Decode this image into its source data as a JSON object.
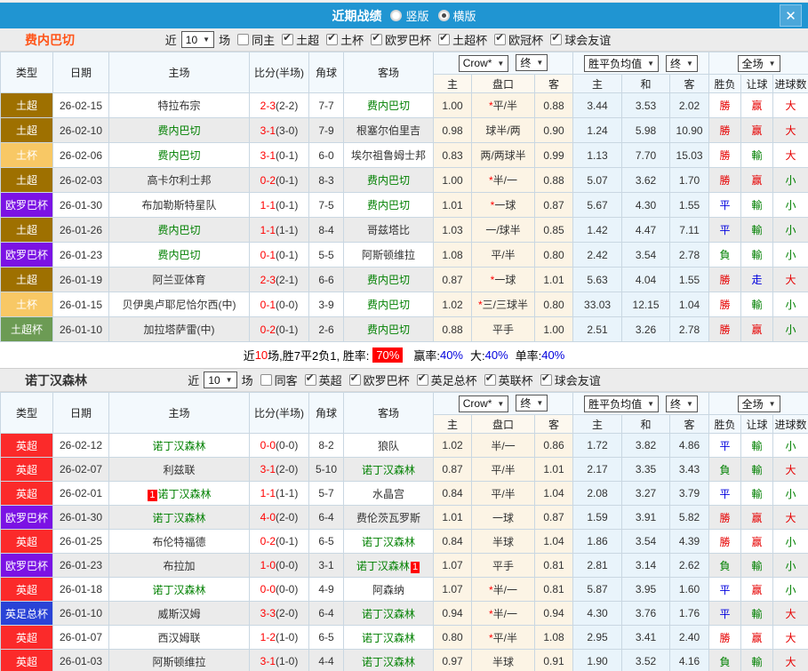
{
  "icons": {
    "dropdown": "▼",
    "close": "✕",
    "check": "✔"
  },
  "titlebar": {
    "title": "近期战绩",
    "vertical_label": "竖版",
    "horizontal_label": "横版",
    "horizontal_selected": true,
    "bg_color": "#2095d2"
  },
  "header": {
    "col_type": "类型",
    "col_date": "日期",
    "col_home": "主场",
    "col_score": "比分(半场)",
    "col_corner": "角球",
    "col_away": "客场",
    "odds_company": "Crow*",
    "odds_final": "终",
    "avg_label": "胜平负均值",
    "avg_final": "终",
    "scope": "全场",
    "sub_home": "主",
    "sub_handicap": "盘口",
    "sub_away": "客",
    "sub_win": "主",
    "sub_draw": "和",
    "sub_lose": "客",
    "col_result": "胜负",
    "col_handicap_result": "让球",
    "col_goals": "进球数"
  },
  "league_colors": {
    "土超": "#9e7000",
    "土杯": "#f8c865",
    "欧罗巴杯": "#7b12e4",
    "土超杯": "#6c9b54",
    "英超": "#fb2a2a",
    "英足总杯": "#2a43d6"
  },
  "result_colors": {
    "勝": "red",
    "平": "blue",
    "負": "green",
    "赢": "red",
    "輸": "green",
    "走": "blue",
    "大": "red",
    "小": "green"
  },
  "subject_color": "#008000",
  "sections": [
    {
      "team": "费内巴切",
      "team_color": "#ff5418",
      "filters": {
        "near_label": "近",
        "recent_value": "10",
        "matches_label": "场",
        "same_label": "同主",
        "same_checked": false,
        "leagues": [
          "土超",
          "土杯",
          "欧罗巴杯",
          "土超杯",
          "欧冠杯",
          "球会友谊"
        ]
      },
      "rows": [
        {
          "league": "土超",
          "date": "26-02-15",
          "home": "特拉布宗",
          "home_subject": false,
          "score": "2-3",
          "half": "(2-2)",
          "corner": "7-7",
          "away": "费内巴切",
          "away_subject": true,
          "odds": [
            "1.00",
            "*平/半",
            "0.88"
          ],
          "avg": [
            "3.44",
            "3.53",
            "2.02"
          ],
          "results": [
            "勝",
            "赢",
            "大"
          ]
        },
        {
          "league": "土超",
          "date": "26-02-10",
          "home": "费内巴切",
          "home_subject": true,
          "score": "3-1",
          "half": "(3-0)",
          "corner": "7-9",
          "away": "根塞尔伯里吉",
          "away_subject": false,
          "odds": [
            "0.98",
            "球半/两",
            "0.90"
          ],
          "avg": [
            "1.24",
            "5.98",
            "10.90"
          ],
          "results": [
            "勝",
            "赢",
            "大"
          ]
        },
        {
          "league": "土杯",
          "date": "26-02-06",
          "home": "费内巴切",
          "home_subject": true,
          "score": "3-1",
          "half": "(0-1)",
          "corner": "6-0",
          "away": "埃尔祖鲁姆士邦",
          "away_subject": false,
          "odds": [
            "0.83",
            "两/两球半",
            "0.99"
          ],
          "avg": [
            "1.13",
            "7.70",
            "15.03"
          ],
          "results": [
            "勝",
            "輸",
            "大"
          ]
        },
        {
          "league": "土超",
          "date": "26-02-03",
          "home": "高卡尔利士邦",
          "home_subject": false,
          "score": "0-2",
          "half": "(0-1)",
          "corner": "8-3",
          "away": "费内巴切",
          "away_subject": true,
          "odds": [
            "1.00",
            "*半/一",
            "0.88"
          ],
          "avg": [
            "5.07",
            "3.62",
            "1.70"
          ],
          "results": [
            "勝",
            "赢",
            "小"
          ]
        },
        {
          "league": "欧罗巴杯",
          "date": "26-01-30",
          "home": "布加勒斯特星队",
          "home_subject": false,
          "score": "1-1",
          "half": "(0-1)",
          "corner": "7-5",
          "away": "费内巴切",
          "away_subject": true,
          "odds": [
            "1.01",
            "*一球",
            "0.87"
          ],
          "avg": [
            "5.67",
            "4.30",
            "1.55"
          ],
          "results": [
            "平",
            "輸",
            "小"
          ]
        },
        {
          "league": "土超",
          "date": "26-01-26",
          "home": "费内巴切",
          "home_subject": true,
          "score": "1-1",
          "half": "(1-1)",
          "corner": "8-4",
          "away": "哥兹塔比",
          "away_subject": false,
          "odds": [
            "1.03",
            "一/球半",
            "0.85"
          ],
          "avg": [
            "1.42",
            "4.47",
            "7.11"
          ],
          "results": [
            "平",
            "輸",
            "小"
          ]
        },
        {
          "league": "欧罗巴杯",
          "date": "26-01-23",
          "home": "费内巴切",
          "home_subject": true,
          "score": "0-1",
          "half": "(0-1)",
          "corner": "5-5",
          "away": "阿斯顿维拉",
          "away_subject": false,
          "odds": [
            "1.08",
            "平/半",
            "0.80"
          ],
          "avg": [
            "2.42",
            "3.54",
            "2.78"
          ],
          "results": [
            "負",
            "輸",
            "小"
          ]
        },
        {
          "league": "土超",
          "date": "26-01-19",
          "home": "阿兰亚体育",
          "home_subject": false,
          "score": "2-3",
          "half": "(2-1)",
          "corner": "6-6",
          "away": "费内巴切",
          "away_subject": true,
          "odds": [
            "0.87",
            "*一球",
            "1.01"
          ],
          "avg": [
            "5.63",
            "4.04",
            "1.55"
          ],
          "results": [
            "勝",
            "走",
            "大"
          ]
        },
        {
          "league": "土杯",
          "date": "26-01-15",
          "home": "贝伊奥卢耶尼恰尔西(中)",
          "home_subject": false,
          "score": "0-1",
          "half": "(0-0)",
          "corner": "3-9",
          "away": "费内巴切",
          "away_subject": true,
          "odds": [
            "1.02",
            "*三/三球半",
            "0.80"
          ],
          "avg": [
            "33.03",
            "12.15",
            "1.04"
          ],
          "results": [
            "勝",
            "輸",
            "小"
          ]
        },
        {
          "league": "土超杯",
          "date": "26-01-10",
          "home": "加拉塔萨雷(中)",
          "home_subject": false,
          "score": "0-2",
          "half": "(0-1)",
          "corner": "2-6",
          "away": "费内巴切",
          "away_subject": true,
          "odds": [
            "0.88",
            "平手",
            "1.00"
          ],
          "avg": [
            "2.51",
            "3.26",
            "2.78"
          ],
          "results": [
            "勝",
            "赢",
            "小"
          ]
        }
      ],
      "summary": {
        "prefix": "近",
        "count": "10",
        "middle": "场,胜7平2负1, 胜率:",
        "win_rate": "70%",
        "stats": [
          {
            "label": "赢率:",
            "value": "40%"
          },
          {
            "label": "大:",
            "value": "40%"
          },
          {
            "label": "单率:",
            "value": "40%"
          }
        ]
      }
    },
    {
      "team": "诺丁汉森林",
      "team_color": "#333333",
      "filters": {
        "near_label": "近",
        "recent_value": "10",
        "matches_label": "场",
        "same_label": "同客",
        "same_checked": false,
        "leagues": [
          "英超",
          "欧罗巴杯",
          "英足总杯",
          "英联杯",
          "球会友谊"
        ]
      },
      "rows": [
        {
          "league": "英超",
          "date": "26-02-12",
          "home": "诺丁汉森林",
          "home_subject": true,
          "score": "0-0",
          "half": "(0-0)",
          "corner": "8-2",
          "away": "狼队",
          "away_subject": false,
          "odds": [
            "1.02",
            "半/一",
            "0.86"
          ],
          "avg": [
            "1.72",
            "3.82",
            "4.86"
          ],
          "results": [
            "平",
            "輸",
            "小"
          ]
        },
        {
          "league": "英超",
          "date": "26-02-07",
          "home": "利兹联",
          "home_subject": false,
          "score": "3-1",
          "half": "(2-0)",
          "corner": "5-10",
          "away": "诺丁汉森林",
          "away_subject": true,
          "odds": [
            "0.87",
            "平/半",
            "1.01"
          ],
          "avg": [
            "2.17",
            "3.35",
            "3.43"
          ],
          "results": [
            "負",
            "輸",
            "大"
          ]
        },
        {
          "league": "英超",
          "date": "26-02-01",
          "home": "诺丁汉森林",
          "home_subject": true,
          "home_badge": "1",
          "score": "1-1",
          "half": "(1-1)",
          "corner": "5-7",
          "away": "水晶宫",
          "away_subject": false,
          "odds": [
            "0.84",
            "平/半",
            "1.04"
          ],
          "avg": [
            "2.08",
            "3.27",
            "3.79"
          ],
          "results": [
            "平",
            "輸",
            "小"
          ]
        },
        {
          "league": "欧罗巴杯",
          "date": "26-01-30",
          "home": "诺丁汉森林",
          "home_subject": true,
          "score": "4-0",
          "half": "(2-0)",
          "corner": "6-4",
          "away": "费伦茨瓦罗斯",
          "away_subject": false,
          "odds": [
            "1.01",
            "一球",
            "0.87"
          ],
          "avg": [
            "1.59",
            "3.91",
            "5.82"
          ],
          "results": [
            "勝",
            "赢",
            "大"
          ]
        },
        {
          "league": "英超",
          "date": "26-01-25",
          "home": "布伦特福德",
          "home_subject": false,
          "score": "0-2",
          "half": "(0-1)",
          "corner": "6-5",
          "away": "诺丁汉森林",
          "away_subject": true,
          "odds": [
            "0.84",
            "半球",
            "1.04"
          ],
          "avg": [
            "1.86",
            "3.54",
            "4.39"
          ],
          "results": [
            "勝",
            "赢",
            "小"
          ]
        },
        {
          "league": "欧罗巴杯",
          "date": "26-01-23",
          "home": "布拉加",
          "home_subject": false,
          "score": "1-0",
          "half": "(0-0)",
          "corner": "3-1",
          "away": "诺丁汉森林",
          "away_subject": true,
          "away_badge": "1",
          "odds": [
            "1.07",
            "平手",
            "0.81"
          ],
          "avg": [
            "2.81",
            "3.14",
            "2.62"
          ],
          "results": [
            "負",
            "輸",
            "小"
          ]
        },
        {
          "league": "英超",
          "date": "26-01-18",
          "home": "诺丁汉森林",
          "home_subject": true,
          "score": "0-0",
          "half": "(0-0)",
          "corner": "4-9",
          "away": "阿森纳",
          "away_subject": false,
          "odds": [
            "1.07",
            "*半/一",
            "0.81"
          ],
          "avg": [
            "5.87",
            "3.95",
            "1.60"
          ],
          "results": [
            "平",
            "赢",
            "小"
          ]
        },
        {
          "league": "英足总杯",
          "date": "26-01-10",
          "home": "威斯汉姆",
          "home_subject": false,
          "score": "3-3",
          "half": "(2-0)",
          "corner": "6-4",
          "away": "诺丁汉森林",
          "away_subject": true,
          "odds": [
            "0.94",
            "*半/一",
            "0.94"
          ],
          "avg": [
            "4.30",
            "3.76",
            "1.76"
          ],
          "results": [
            "平",
            "輸",
            "大"
          ]
        },
        {
          "league": "英超",
          "date": "26-01-07",
          "home": "西汉姆联",
          "home_subject": false,
          "score": "1-2",
          "half": "(1-0)",
          "corner": "6-5",
          "away": "诺丁汉森林",
          "away_subject": true,
          "odds": [
            "0.80",
            "*平/半",
            "1.08"
          ],
          "avg": [
            "2.95",
            "3.41",
            "2.40"
          ],
          "results": [
            "勝",
            "赢",
            "大"
          ]
        },
        {
          "league": "英超",
          "date": "26-01-03",
          "home": "阿斯顿维拉",
          "home_subject": false,
          "score": "3-1",
          "half": "(1-0)",
          "corner": "4-4",
          "away": "诺丁汉森林",
          "away_subject": true,
          "odds": [
            "0.97",
            "半球",
            "0.91"
          ],
          "avg": [
            "1.90",
            "3.52",
            "4.16"
          ],
          "results": [
            "負",
            "輸",
            "大"
          ]
        }
      ]
    }
  ]
}
